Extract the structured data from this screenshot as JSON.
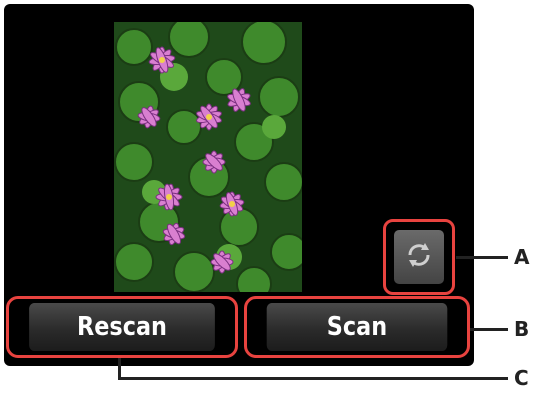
{
  "buttons": {
    "rescan_label": "Rescan",
    "scan_label": "Scan",
    "rotate_icon": "rotate-icon"
  },
  "callouts": {
    "a": "A",
    "b": "B",
    "c": "C"
  },
  "colors": {
    "highlight": "#e8433f",
    "screen": "#000000",
    "button": "#2b2b2b"
  }
}
